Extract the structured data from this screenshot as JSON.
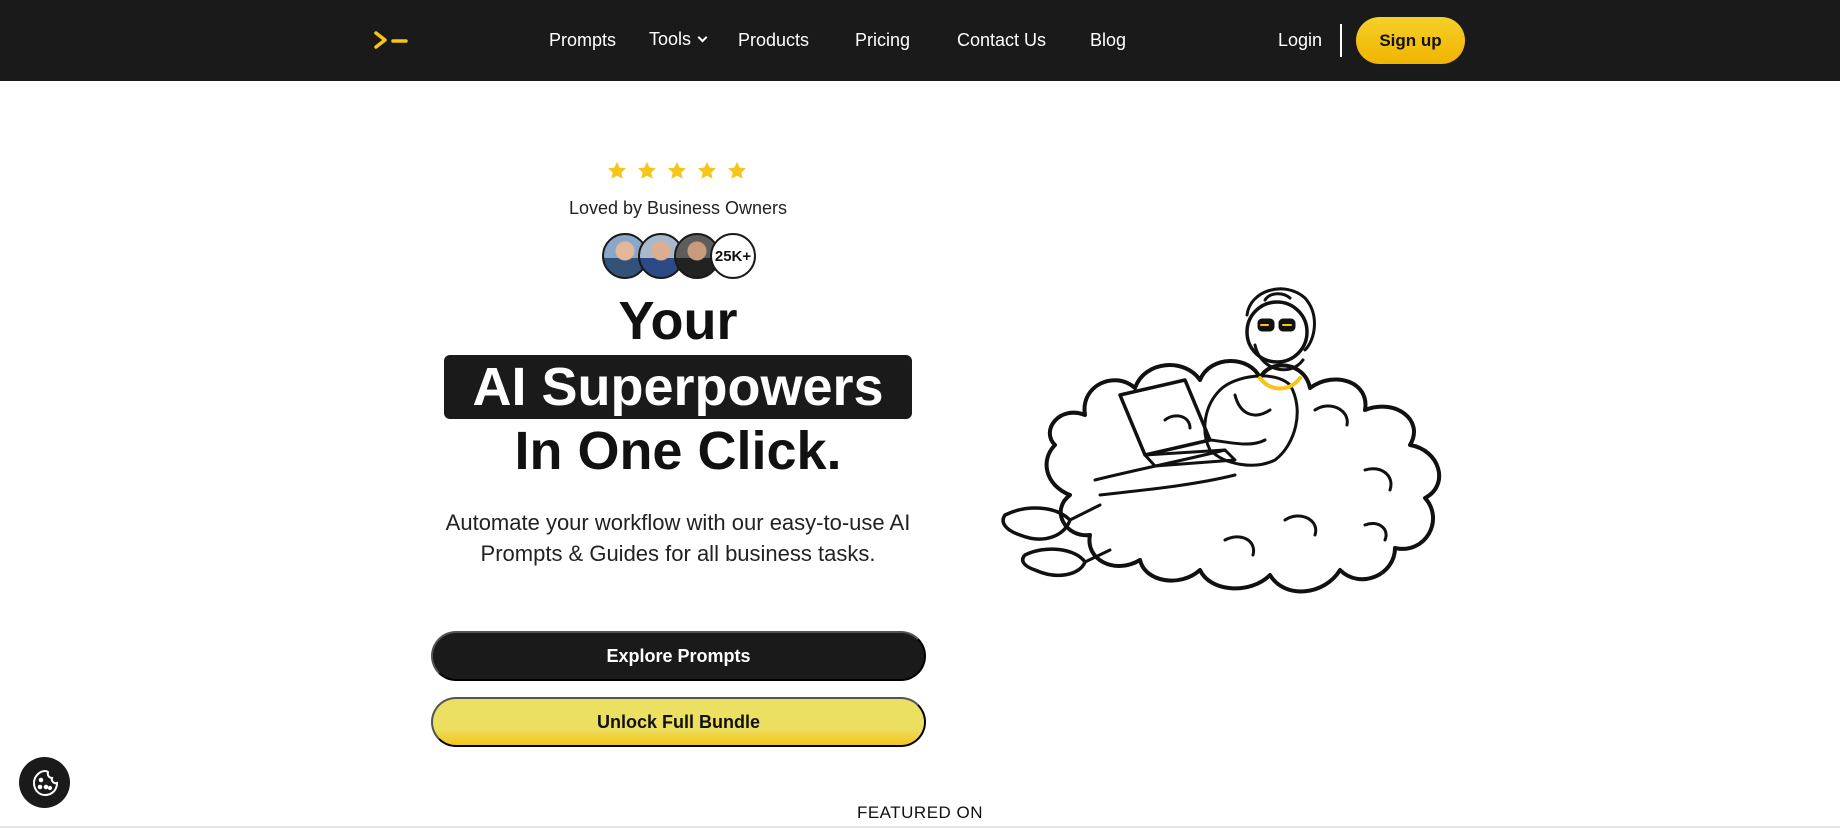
{
  "nav": {
    "logo_icon": "terminal-prompt-logo",
    "links": [
      {
        "label": "Prompts"
      },
      {
        "label": "Tools",
        "has_dropdown": true
      },
      {
        "label": "Products"
      },
      {
        "label": "Pricing"
      },
      {
        "label": "Contact Us"
      },
      {
        "label": "Blog"
      }
    ],
    "login_label": "Login",
    "signup_label": "Sign up"
  },
  "hero": {
    "rating_stars": 5,
    "rating_label": "Loved by Business Owners",
    "user_count": "25K+",
    "headline_line1": "Your",
    "headline_highlight": "AI Superpowers",
    "headline_line3": "In One Click.",
    "subtitle": "Automate your workflow with our easy-to-use AI Prompts & Guides for all business tasks.",
    "cta_primary": "Explore Prompts",
    "cta_secondary": "Unlock Full Bundle"
  },
  "featured_label": "FEATURED ON",
  "colors": {
    "nav_bg": "#1a1a1a",
    "accent_yellow": "#f5c518",
    "text_dark": "#111111"
  },
  "icons": {
    "cookie": "cookie-icon",
    "star": "star-icon",
    "chevron": "chevron-down-icon"
  }
}
